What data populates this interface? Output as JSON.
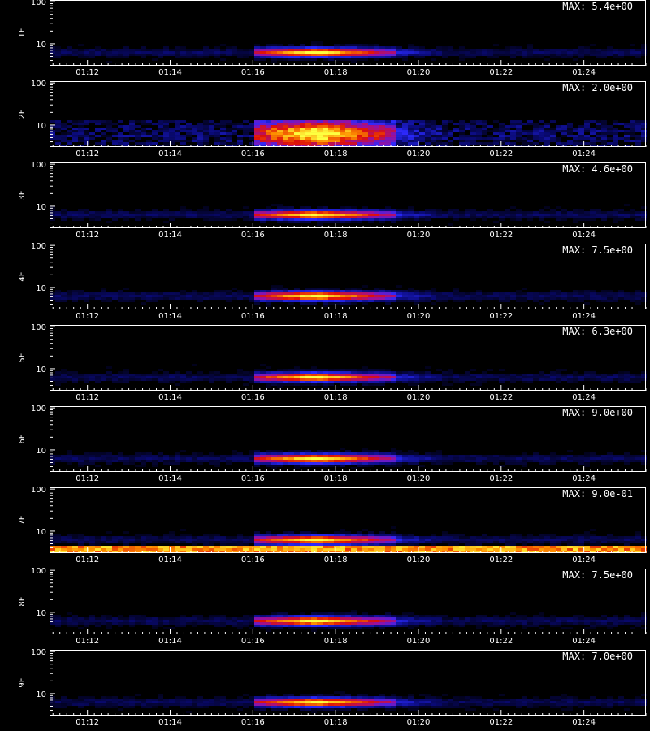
{
  "chart_data": {
    "type": "heatmap",
    "x_ticks": [
      "01:12",
      "01:14",
      "01:16",
      "01:18",
      "01:20",
      "01:22",
      "01:24"
    ],
    "x_range": [
      "01:11:05",
      "01:25:30"
    ],
    "y_ticks": [
      "10",
      "100"
    ],
    "y_scale": "log",
    "y_range": [
      3,
      110
    ],
    "colormap": [
      "#000000",
      "#0a0a78",
      "#2a2aff",
      "#9a10a0",
      "#e01008",
      "#ff9000",
      "#ffff40"
    ],
    "xlabel": "",
    "panels": [
      {
        "label": "1F",
        "max_label": "MAX: 5.4e+00"
      },
      {
        "label": "2F",
        "max_label": "MAX: 2.0e+00"
      },
      {
        "label": "3F",
        "max_label": "MAX: 4.6e+00"
      },
      {
        "label": "4F",
        "max_label": "MAX: 7.5e+00"
      },
      {
        "label": "5F",
        "max_label": "MAX: 6.3e+00"
      },
      {
        "label": "6F",
        "max_label": "MAX: 9.0e+00"
      },
      {
        "label": "7F",
        "max_label": "MAX: 9.0e-01"
      },
      {
        "label": "8F",
        "max_label": "MAX: 7.5e+00"
      },
      {
        "label": "9F",
        "max_label": "MAX: 7.0e+00"
      }
    ]
  }
}
